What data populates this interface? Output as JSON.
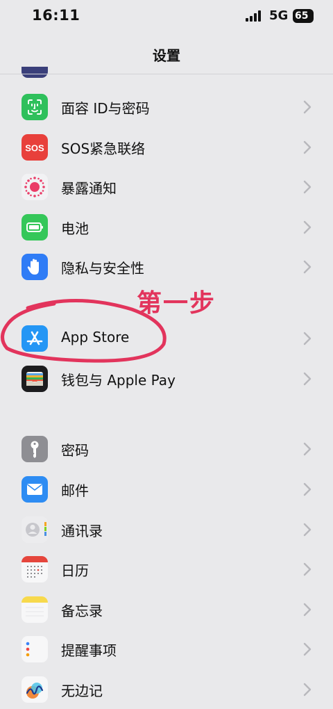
{
  "status_bar": {
    "time": "16:11",
    "network": "5G",
    "battery": "65"
  },
  "nav": {
    "title": "设置"
  },
  "group1": [
    {
      "label": "面容 ID与密码",
      "icon": "face-id-icon"
    },
    {
      "label": "SOS紧急联络",
      "icon": "sos-icon",
      "icon_text": "SOS"
    },
    {
      "label": "暴露通知",
      "icon": "exposure-notification-icon"
    },
    {
      "label": "电池",
      "icon": "battery-icon"
    },
    {
      "label": "隐私与安全性",
      "icon": "hand-privacy-icon"
    }
  ],
  "group2": [
    {
      "label": "App Store",
      "icon": "app-store-icon"
    },
    {
      "label": "钱包与 Apple Pay",
      "icon": "wallet-icon"
    }
  ],
  "group3": [
    {
      "label": "密码",
      "icon": "key-icon"
    },
    {
      "label": "邮件",
      "icon": "mail-icon"
    },
    {
      "label": "通讯录",
      "icon": "contacts-icon"
    },
    {
      "label": "日历",
      "icon": "calendar-icon"
    },
    {
      "label": "备忘录",
      "icon": "notes-icon"
    },
    {
      "label": "提醒事项",
      "icon": "reminders-icon"
    },
    {
      "label": "无边记",
      "icon": "freeform-icon"
    }
  ],
  "annotation": {
    "text": "第一步",
    "color": "#e2345c"
  },
  "colors": {
    "background": "#e9e9eb",
    "chevron": "#b8b8bd"
  }
}
